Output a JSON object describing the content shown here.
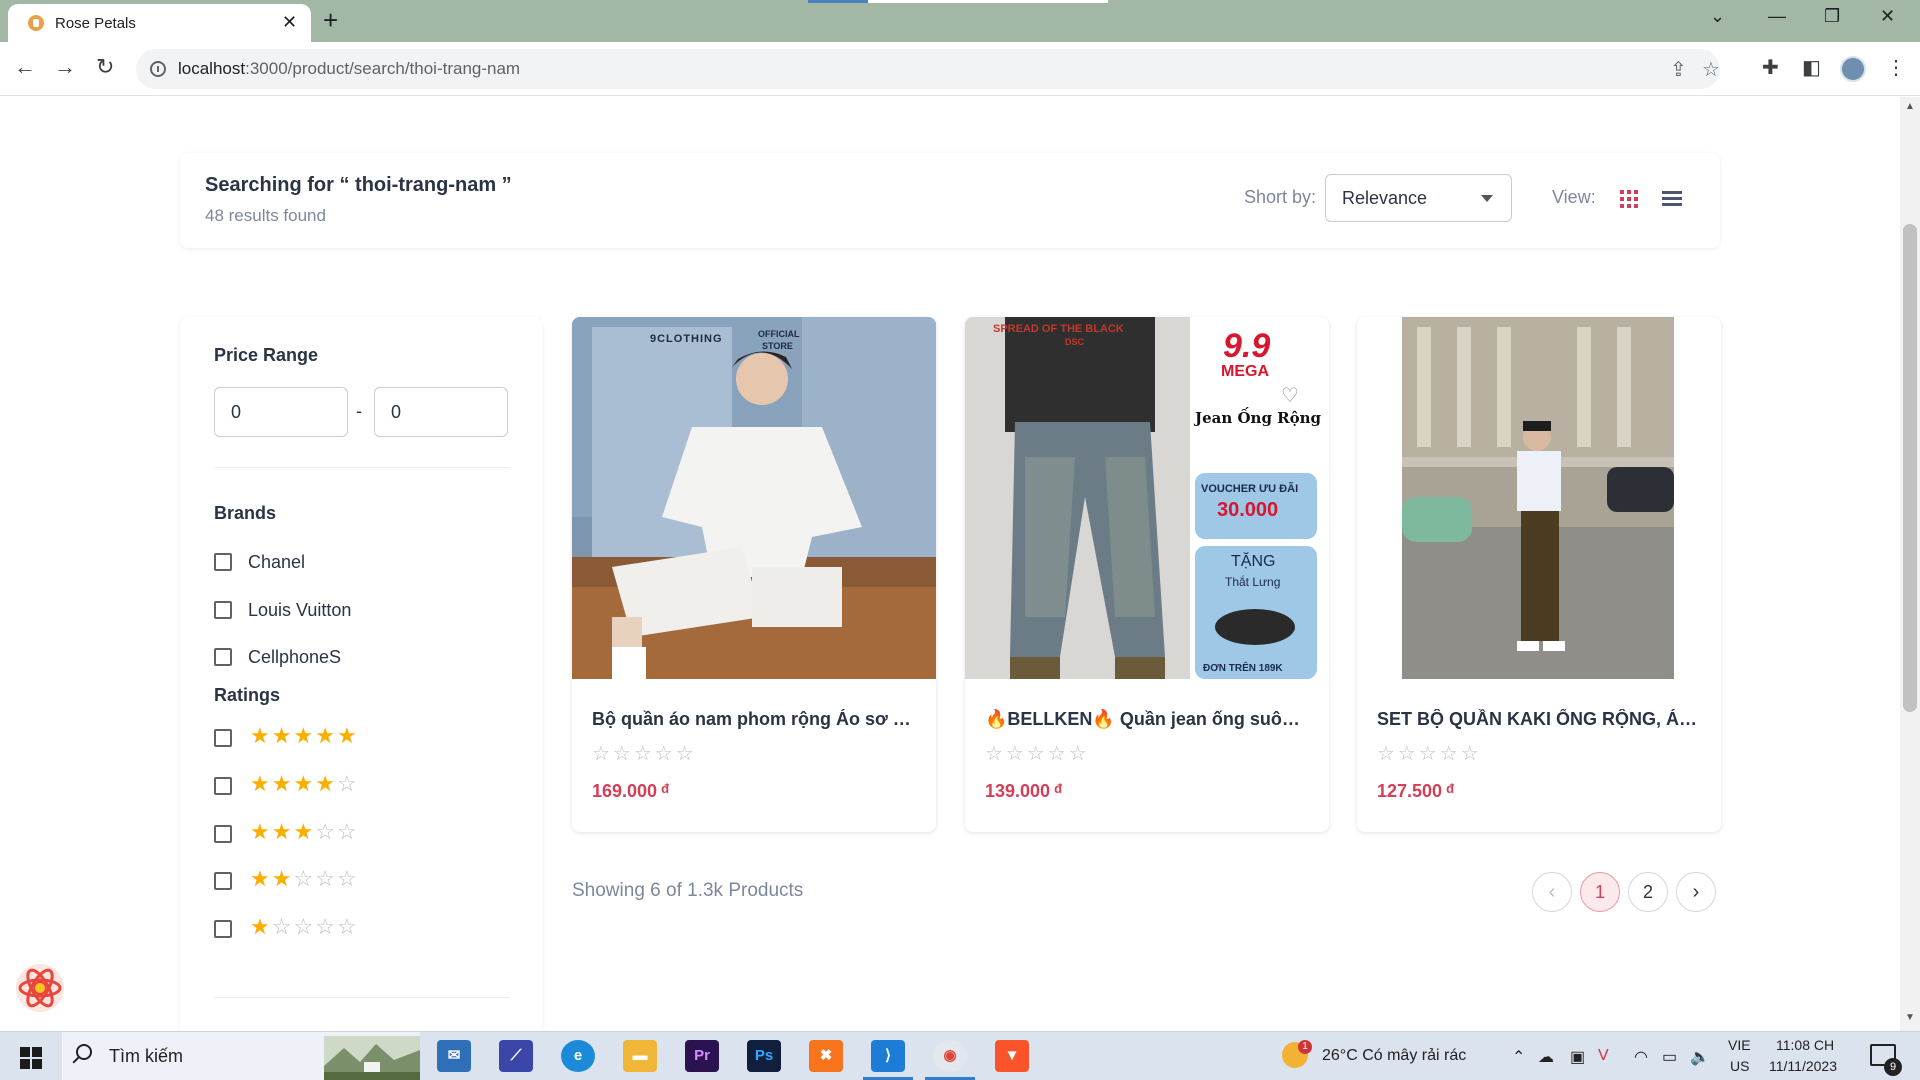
{
  "browser": {
    "tab_title": "Rose Petals",
    "url_host": "localhost",
    "url_rest": ":3000/product/search/thoi-trang-nam"
  },
  "search": {
    "title": "Searching for “ thoi-trang-nam ”",
    "count": "48 results found",
    "sort_label": "Short by:",
    "sort_value": "Relevance",
    "view_label": "View:"
  },
  "filters": {
    "price_heading": "Price Range",
    "price_min": "0",
    "price_max": "0",
    "price_separator": "-",
    "brands_heading": "Brands",
    "brands": [
      {
        "label": "Chanel",
        "checked": false
      },
      {
        "label": "Louis Vuitton",
        "checked": false
      },
      {
        "label": "CellphoneS",
        "checked": false
      }
    ],
    "ratings_heading": "Ratings",
    "ratings": [
      5,
      4,
      3,
      2,
      1
    ]
  },
  "products": [
    {
      "title": "Bộ quần áo nam phom rộng Áo sơ mi cộc tay",
      "price": "169.000",
      "currency": "đ",
      "rating": 0,
      "image": "white-set-photo"
    },
    {
      "title": "🔥BELLKEN🔥 Quần jean ống suông rộng",
      "price": "139.000",
      "currency": "đ",
      "rating": 0,
      "image": "jeans-promo-photo",
      "promo": {
        "mega": "9.9",
        "mega_sub": "MEGA",
        "headline": "Jean Ống Rộng",
        "voucher": "VOUCHER ƯU ĐÃI",
        "voucher_value": "30.000",
        "gift": "TẶNG",
        "gift_item": "Thắt Lưng",
        "gift_cond": "ĐƠN TRÊN 189K"
      }
    },
    {
      "title": "SET BỘ QUẦN KAKI ỐNG RỘNG, ÁO THUN",
      "price": "127.500",
      "currency": "đ",
      "rating": 0,
      "image": "street-outfit-photo"
    }
  ],
  "pagination": {
    "showing": "Showing 6 of 1.3k Products",
    "pages": [
      "1",
      "2"
    ],
    "current": "1"
  },
  "image_text": {
    "brand_tag": "9CLOTHING",
    "official": "OFFICIAL",
    "store": "STORE",
    "shirt_print": "SPREAD OF THE BLACK",
    "shirt_sub": "DSC"
  },
  "taskbar": {
    "search_placeholder": "Tìm kiếm",
    "weather": "26°C  Có mây rải rác",
    "weather_alert": "1",
    "lang_top": "VIE",
    "lang_bottom": "US",
    "time": "11:08 CH",
    "date": "11/11/2023",
    "notifications": "9",
    "apps": [
      "mail",
      "vscode-insiders",
      "edge",
      "file-explorer",
      "premiere-pro",
      "photoshop",
      "xampp",
      "vscode",
      "chrome",
      "brave"
    ]
  },
  "colors": {
    "accent": "#d23f57",
    "star": "#faaf00",
    "tabbar": "#a3b8a4"
  }
}
